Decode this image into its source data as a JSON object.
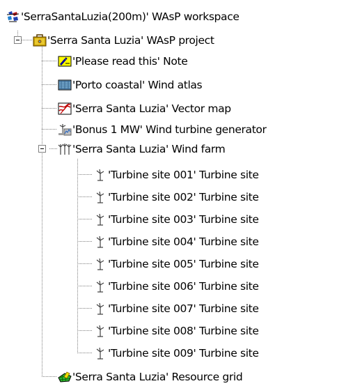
{
  "tree": {
    "workspace": {
      "label": "'SerraSantaLuzia(200m)' WAsP workspace",
      "icon": "workspace-icon"
    },
    "project": {
      "label": "'Serra Santa Luzia' WAsP project",
      "icon": "project-briefcase-icon",
      "expanded": true,
      "children": [
        {
          "label": "'Please read this' Note",
          "icon": "note-icon"
        },
        {
          "label": "'Porto coastal' Wind atlas",
          "icon": "wind-atlas-icon"
        },
        {
          "label": "'Serra Santa Luzia' Vector map",
          "icon": "vector-map-icon"
        },
        {
          "label": "'Bonus 1 MW' Wind turbine generator",
          "icon": "wind-turbine-generator-icon"
        }
      ]
    },
    "wind_farm": {
      "label": "'Serra Santa Luzia' Wind farm",
      "icon": "wind-farm-icon",
      "expanded": true,
      "sites": [
        {
          "label": "'Turbine site 001' Turbine site",
          "icon": "turbine-site-icon"
        },
        {
          "label": "'Turbine site 002' Turbine site",
          "icon": "turbine-site-icon"
        },
        {
          "label": "'Turbine site 003' Turbine site",
          "icon": "turbine-site-icon"
        },
        {
          "label": "'Turbine site 004' Turbine site",
          "icon": "turbine-site-icon"
        },
        {
          "label": "'Turbine site 005' Turbine site",
          "icon": "turbine-site-icon"
        },
        {
          "label": "'Turbine site 006' Turbine site",
          "icon": "turbine-site-icon"
        },
        {
          "label": "'Turbine site 007' Turbine site",
          "icon": "turbine-site-icon"
        },
        {
          "label": "'Turbine site 008' Turbine site",
          "icon": "turbine-site-icon"
        },
        {
          "label": "'Turbine site 009' Turbine site",
          "icon": "turbine-site-icon"
        }
      ]
    },
    "resource_grid": {
      "label": "'Serra Santa Luzia' Resource grid",
      "icon": "resource-grid-icon"
    }
  }
}
